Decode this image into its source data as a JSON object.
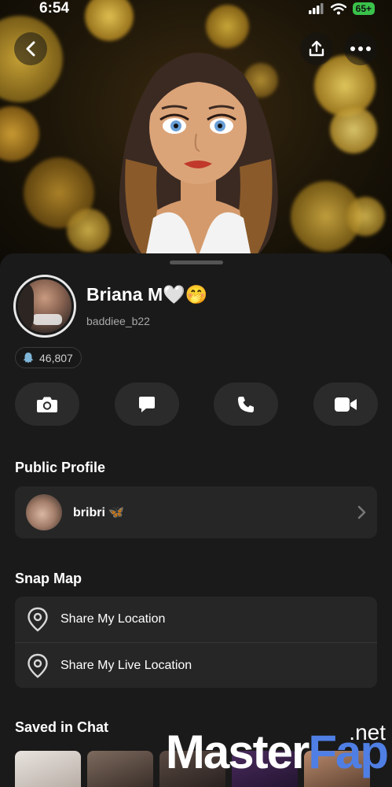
{
  "status_bar": {
    "time": "6:54",
    "battery": "65+"
  },
  "header": {
    "back_icon": "chevron-left-icon",
    "share_icon": "share-upload-icon",
    "more_icon": "more-horizontal-icon"
  },
  "profile": {
    "display_name": "Briana M🤍🤭",
    "username": "baddiee_b22",
    "snap_score": "46,807",
    "score_icon": "ghost-icon"
  },
  "actions": [
    {
      "icon": "camera-icon"
    },
    {
      "icon": "chat-icon"
    },
    {
      "icon": "phone-icon"
    },
    {
      "icon": "video-icon"
    }
  ],
  "public_profile": {
    "title": "Public Profile",
    "name": "bribri 🦋"
  },
  "snap_map": {
    "title": "Snap Map",
    "items": [
      {
        "label": "Share My Location"
      },
      {
        "label": "Share My Live Location"
      }
    ]
  },
  "saved_in_chat": {
    "title": "Saved in Chat"
  },
  "watermark": {
    "brand_main": "Master",
    "brand_accent": "Fap",
    "tld": ".net"
  },
  "colors": {
    "background": "#121212",
    "sheet": "#1a1a1a",
    "card": "#262626",
    "action_button": "#2b2b2b",
    "battery": "#3ac24a",
    "watermark_accent": "#4f7fe5"
  }
}
